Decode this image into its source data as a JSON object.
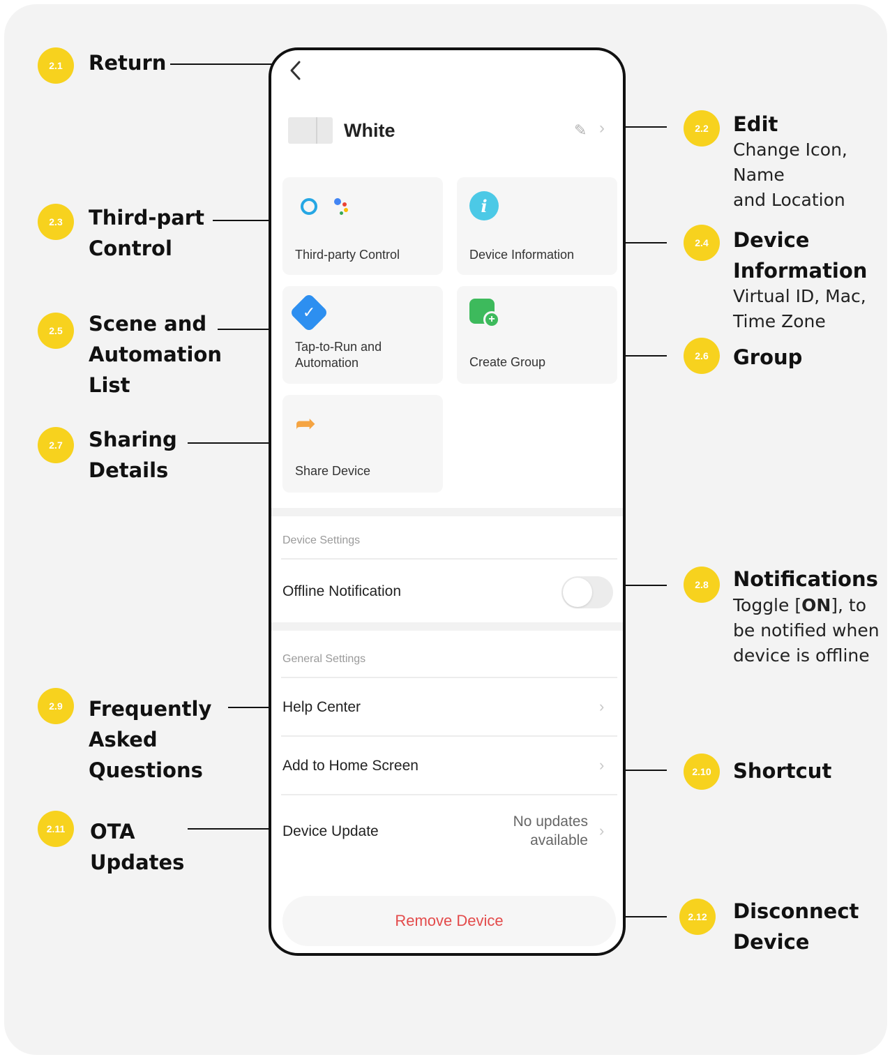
{
  "colors": {
    "accent_badge": "#f7d21e",
    "danger": "#e34b4b",
    "card_bg": "#f3f3f3"
  },
  "callouts": [
    {
      "id": "2.1",
      "title": "Return",
      "desc": ""
    },
    {
      "id": "2.2",
      "title": "Edit",
      "desc": "Change Icon,\nName\nand Location"
    },
    {
      "id": "2.3",
      "title": "Third-part\nControl",
      "desc": ""
    },
    {
      "id": "2.4",
      "title": "Device\nInformation",
      "desc": "Virtual ID, Mac,\nTime Zone"
    },
    {
      "id": "2.5",
      "title": "Scene and\nAutomation\nList",
      "desc": ""
    },
    {
      "id": "2.6",
      "title": "Group",
      "desc": ""
    },
    {
      "id": "2.7",
      "title": "Sharing\nDetails",
      "desc": ""
    },
    {
      "id": "2.8",
      "title": "Notifications",
      "desc_before": "Toggle [",
      "desc_bold": "ON",
      "desc_after": "], to\nbe notified when\ndevice is offline"
    },
    {
      "id": "2.9",
      "title": "Frequently\nAsked\nQuestions",
      "desc": ""
    },
    {
      "id": "2.10",
      "title": "Shortcut",
      "desc": ""
    },
    {
      "id": "2.11",
      "title": "OTA\nUpdates",
      "desc": ""
    },
    {
      "id": "2.12",
      "title": "Disconnect\nDevice",
      "desc": ""
    }
  ],
  "phone": {
    "back_icon": "chevron-left",
    "device_name": "White",
    "tiles": [
      {
        "label": "Third-party Control",
        "icon": "alexa-google-icon"
      },
      {
        "label": "Device Information",
        "icon": "info-icon"
      },
      {
        "label": "Tap-to-Run and\nAutomation",
        "icon": "automation-check-icon"
      },
      {
        "label": "Create Group",
        "icon": "group-add-icon"
      },
      {
        "label": "Share Device",
        "icon": "share-arrow-icon"
      }
    ],
    "device_settings_label": "Device Settings",
    "offline_notification_label": "Offline Notification",
    "offline_notification_on": false,
    "general_settings_label": "General Settings",
    "help_center_label": "Help Center",
    "add_home_label": "Add to Home Screen",
    "device_update_label": "Device Update",
    "device_update_status": "No updates\navailable",
    "remove_label": "Remove Device"
  }
}
